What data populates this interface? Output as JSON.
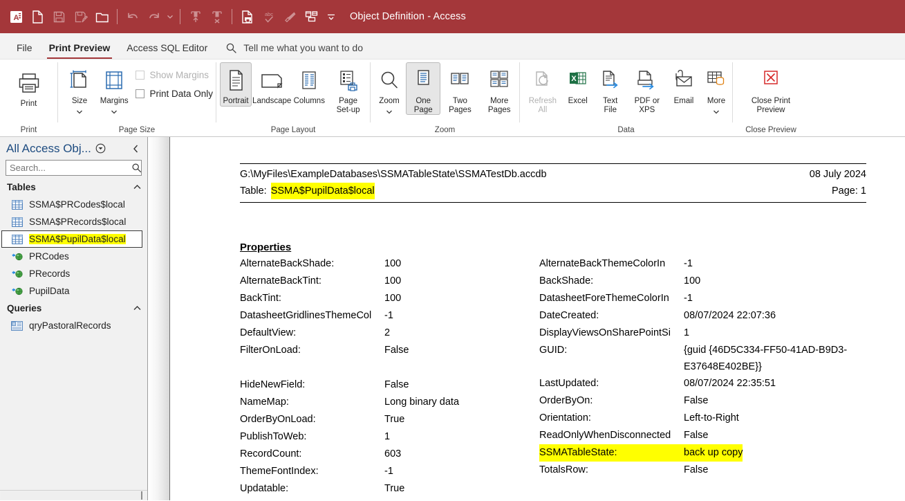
{
  "window": {
    "title": "Object Definition  -  Access",
    "titlebar_color": "#a4373a"
  },
  "quick_access": [
    {
      "name": "access-logo-icon",
      "label": "Access",
      "enabled": true
    },
    {
      "name": "new-file-icon",
      "label": "New",
      "enabled": true
    },
    {
      "name": "save-icon",
      "label": "Save",
      "enabled": false
    },
    {
      "name": "save-as-icon",
      "label": "Save As",
      "enabled": false
    },
    {
      "name": "open-folder-icon",
      "label": "Open",
      "enabled": true
    },
    {
      "name": "undo-icon",
      "label": "Undo",
      "enabled": false
    },
    {
      "name": "redo-icon",
      "label": "Redo",
      "enabled": false
    },
    {
      "name": "insert-row-icon",
      "label": "Insert Rows",
      "enabled": false
    },
    {
      "name": "delete-row-icon",
      "label": "Delete Rows",
      "enabled": false
    },
    {
      "name": "print-preview-icon",
      "label": "Print Preview",
      "enabled": true
    },
    {
      "name": "spelling-icon",
      "label": "Spelling",
      "enabled": false
    },
    {
      "name": "format-painter-icon",
      "label": "Format Painter",
      "enabled": false
    },
    {
      "name": "relationships-icon",
      "label": "Relationships",
      "enabled": true
    },
    {
      "name": "customize-qat-icon",
      "label": "Customize Quick Access Toolbar",
      "enabled": true
    }
  ],
  "tabs": [
    {
      "label": "File",
      "active": false
    },
    {
      "label": "Print Preview",
      "active": true
    },
    {
      "label": "Access SQL Editor",
      "active": false
    }
  ],
  "tell_me": {
    "placeholder": "Tell me what you want to do",
    "text": "Tell me what you want to do",
    "icon": "search-icon"
  },
  "ribbon": {
    "groups": [
      {
        "label": "Print",
        "items": [
          {
            "label": "Print",
            "icon": "printer-icon",
            "enabled": true,
            "selected": false,
            "dropdown": false
          }
        ]
      },
      {
        "label": "Page Size",
        "items": [
          {
            "label": "Size",
            "icon": "page-size-icon",
            "enabled": true,
            "selected": false,
            "dropdown": true
          },
          {
            "label": "Margins",
            "icon": "margins-icon",
            "enabled": true,
            "selected": false,
            "dropdown": true
          }
        ],
        "checkboxes": [
          {
            "label": "Show Margins",
            "checked": false,
            "enabled": false
          },
          {
            "label": "Print Data Only",
            "checked": false,
            "enabled": true
          }
        ]
      },
      {
        "label": "Page Layout",
        "items": [
          {
            "label": "Portrait",
            "icon": "portrait-icon",
            "enabled": true,
            "selected": true,
            "dropdown": false
          },
          {
            "label": "Landscape",
            "icon": "landscape-icon",
            "enabled": true,
            "selected": false,
            "dropdown": false
          },
          {
            "label": "Columns",
            "icon": "columns-icon",
            "enabled": true,
            "selected": false,
            "dropdown": false
          },
          {
            "label": "Page Set-up",
            "icon": "page-setup-icon",
            "enabled": true,
            "selected": false,
            "dropdown": false
          }
        ]
      },
      {
        "label": "Zoom",
        "items": [
          {
            "label": "Zoom",
            "icon": "magnifier-icon",
            "enabled": true,
            "selected": false,
            "dropdown": true
          },
          {
            "label": "One Page",
            "icon": "one-page-icon",
            "enabled": true,
            "selected": true,
            "dropdown": false
          },
          {
            "label": "Two Pages",
            "icon": "two-pages-icon",
            "enabled": true,
            "selected": false,
            "dropdown": false
          },
          {
            "label": "More Pages",
            "icon": "more-pages-icon",
            "enabled": true,
            "selected": false,
            "dropdown": true
          }
        ]
      },
      {
        "label": "Data",
        "items": [
          {
            "label": "Refresh All",
            "icon": "refresh-all-icon",
            "enabled": false,
            "selected": false,
            "dropdown": false
          },
          {
            "label": "Excel",
            "icon": "excel-icon",
            "enabled": true,
            "selected": false,
            "dropdown": false
          },
          {
            "label": "Text File",
            "icon": "text-file-icon",
            "enabled": true,
            "selected": false,
            "dropdown": false
          },
          {
            "label": "PDF or XPS",
            "icon": "pdf-xps-icon",
            "enabled": true,
            "selected": false,
            "dropdown": false
          },
          {
            "label": "Email",
            "icon": "email-icon",
            "enabled": true,
            "selected": false,
            "dropdown": false
          },
          {
            "label": "More",
            "icon": "more-data-icon",
            "enabled": true,
            "selected": false,
            "dropdown": true
          }
        ]
      },
      {
        "label": "Close Preview",
        "items": [
          {
            "label": "Close Print Preview",
            "icon": "close-print-preview-icon",
            "enabled": true,
            "selected": false,
            "dropdown": false
          }
        ]
      }
    ]
  },
  "nav_pane": {
    "title": "All Access Obj...",
    "dropdown_icon": "chevron-down-circle-icon",
    "collapse_icon": "chevron-left-icon",
    "search_placeholder": "Search...",
    "search_value": "",
    "search_icon": "search-icon",
    "groups": [
      {
        "label": "Tables",
        "expanded": true,
        "items": [
          {
            "label": "SSMA$PRCodes$local",
            "icon": "table-icon",
            "selected": false,
            "highlighted": false
          },
          {
            "label": "SSMA$PRecords$local",
            "icon": "table-icon",
            "selected": false,
            "highlighted": false
          },
          {
            "label": "SSMA$PupilData$local",
            "icon": "table-icon",
            "selected": true,
            "highlighted": true
          },
          {
            "label": "PRCodes",
            "icon": "linked-table-icon",
            "selected": false,
            "highlighted": false
          },
          {
            "label": "PRecords",
            "icon": "linked-table-icon",
            "selected": false,
            "highlighted": false
          },
          {
            "label": "PupilData",
            "icon": "linked-table-icon",
            "selected": false,
            "highlighted": false
          }
        ]
      },
      {
        "label": "Queries",
        "expanded": true,
        "items": [
          {
            "label": "qryPastoralRecords",
            "icon": "query-icon",
            "selected": false,
            "highlighted": false
          }
        ]
      }
    ]
  },
  "document": {
    "header": {
      "path": "G:\\MyFiles\\ExampleDatabases\\SSMATableState\\SSMATestDb.accdb",
      "date": "08 July 2024",
      "table_label": "Table:",
      "table_name": "SSMA$PupilData$local",
      "page_label": "Page: 1"
    },
    "properties_title": "Properties",
    "left_column": [
      {
        "name": "AlternateBackShade:",
        "value": "100",
        "highlighted": false
      },
      {
        "name": "AlternateBackTint:",
        "value": "100",
        "highlighted": false
      },
      {
        "name": "BackTint:",
        "value": "100",
        "highlighted": false
      },
      {
        "name": "DatasheetGridlinesThemeCol",
        "value": "-1",
        "highlighted": false
      },
      {
        "name": "DefaultView:",
        "value": "2",
        "highlighted": false
      },
      {
        "name": "FilterOnLoad:",
        "value": "False",
        "highlighted": false
      },
      {
        "name": "",
        "value": "",
        "highlighted": false
      },
      {
        "name": "HideNewField:",
        "value": "False",
        "highlighted": false
      },
      {
        "name": "NameMap:",
        "value": "Long binary data",
        "highlighted": false
      },
      {
        "name": "OrderByOnLoad:",
        "value": "True",
        "highlighted": false
      },
      {
        "name": "PublishToWeb:",
        "value": "1",
        "highlighted": false
      },
      {
        "name": "RecordCount:",
        "value": "603",
        "highlighted": false
      },
      {
        "name": "ThemeFontIndex:",
        "value": "-1",
        "highlighted": false
      },
      {
        "name": "Updatable:",
        "value": "True",
        "highlighted": false
      }
    ],
    "right_column": [
      {
        "name": "AlternateBackThemeColorIn",
        "value": "-1",
        "highlighted": false
      },
      {
        "name": "BackShade:",
        "value": "100",
        "highlighted": false
      },
      {
        "name": "DatasheetForeThemeColorIn",
        "value": "-1",
        "highlighted": false
      },
      {
        "name": "DateCreated:",
        "value": "08/07/2024 22:07:36",
        "highlighted": false
      },
      {
        "name": "DisplayViewsOnSharePointSi",
        "value": "1",
        "highlighted": false
      },
      {
        "name": "GUID:",
        "value": "{guid {46D5C334-FF50-41AD-B9D3-E37648E402BE}}",
        "highlighted": false,
        "wrap": true
      },
      {
        "name": "LastUpdated:",
        "value": "08/07/2024 22:35:51",
        "highlighted": false
      },
      {
        "name": "OrderByOn:",
        "value": "False",
        "highlighted": false
      },
      {
        "name": "Orientation:",
        "value": "Left-to-Right",
        "highlighted": false
      },
      {
        "name": "ReadOnlyWhenDisconnected",
        "value": "False",
        "highlighted": false
      },
      {
        "name": "SSMATableState:",
        "value": "back up copy",
        "highlighted": true
      },
      {
        "name": "TotalsRow:",
        "value": "False",
        "highlighted": false
      }
    ]
  },
  "colors": {
    "accent": "#a4373a",
    "highlight": "#ffff00",
    "nav_title": "#1e4c80",
    "excel_green": "#1d7044",
    "close_red": "#d62828"
  }
}
